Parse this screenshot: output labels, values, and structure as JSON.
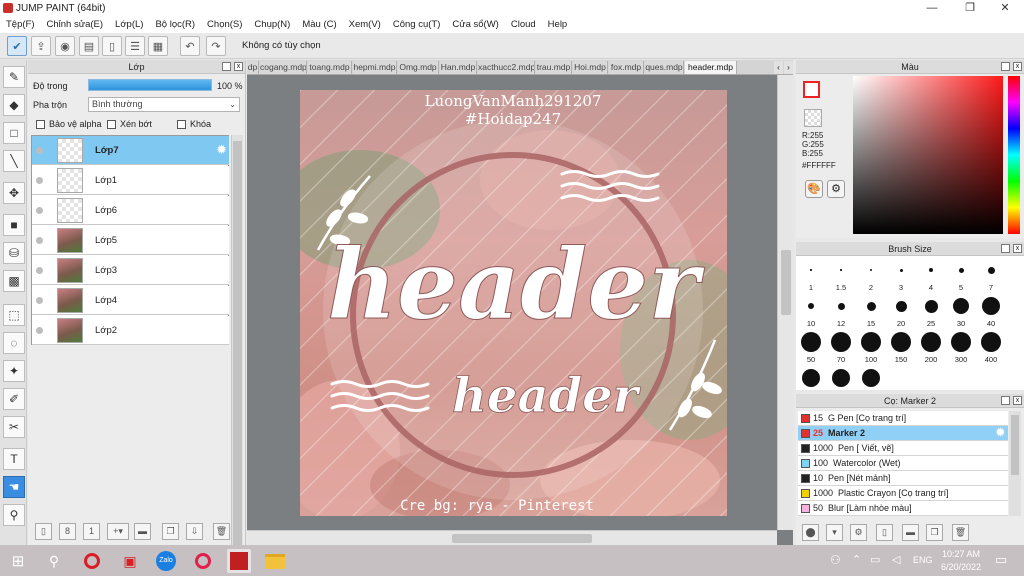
{
  "window": {
    "title": "JUMP PAINT (64bit)",
    "minimize_glyph": "—",
    "maximize_glyph": "❐",
    "close_glyph": "✕"
  },
  "menu": [
    "Tệp(F)",
    "Chỉnh sửa(E)",
    "Lớp(L)",
    "Bộ lọc(R)",
    "Chọn(S)",
    "Chụp(N)",
    "Màu (C)",
    "Xem(V)",
    "Công cụ(T)",
    "Cửa sổ(W)",
    "Cloud",
    "Help"
  ],
  "toolbar": {
    "selection_info": "Không có tùy chọn"
  },
  "layer_panel": {
    "title": "Lớp",
    "opacity_label": "Độ trong",
    "opacity_value": "100 %",
    "opacity_percent": 100,
    "blend_label": "Pha trộn",
    "blend_value": "Bình thường",
    "protect_alpha": "Bảo vệ alpha",
    "clipping": "Xén bớt",
    "lock": "Khóa",
    "layers": [
      {
        "name": "Lớp7",
        "selected": true,
        "has_image": false
      },
      {
        "name": "Lớp1",
        "selected": false,
        "has_image": false
      },
      {
        "name": "Lớp6",
        "selected": false,
        "has_image": false
      },
      {
        "name": "Lớp5",
        "selected": false,
        "has_image": true
      },
      {
        "name": "Lớp3",
        "selected": false,
        "has_image": true
      },
      {
        "name": "Lớp4",
        "selected": false,
        "has_image": true
      },
      {
        "name": "Lớp2",
        "selected": false,
        "has_image": true
      }
    ]
  },
  "tabs": [
    {
      "label": "dp",
      "current": false
    },
    {
      "label": "cogang.mdp",
      "current": false
    },
    {
      "label": "toang.mdp",
      "current": false
    },
    {
      "label": "hepmi.mdp",
      "current": false
    },
    {
      "label": "Omg.mdp",
      "current": false
    },
    {
      "label": "Han.mdp",
      "current": false
    },
    {
      "label": "xacthucc2.mdp",
      "current": false
    },
    {
      "label": "trau.mdp",
      "current": false
    },
    {
      "label": "Hoi.mdp",
      "current": false
    },
    {
      "label": "fox.mdp",
      "current": false
    },
    {
      "label": "ques.mdp",
      "current": false
    },
    {
      "label": "header.mdp",
      "current": true
    }
  ],
  "artwork": {
    "watermark_line1": "LuongVanManh291207",
    "watermark_line2": "#Hoidap247",
    "main_text": "header",
    "sub_text": "header",
    "credit": "Cre bg: rya - Pinterest"
  },
  "color_panel": {
    "title": "Màu",
    "r": "R:255",
    "g": "G:255",
    "b": "B:255",
    "hex": "#FFFFFF",
    "fg": "#ffffff"
  },
  "brush_panel": {
    "title": "Brush Size",
    "sizes": [
      "1",
      "1.5",
      "2",
      "3",
      "4",
      "5",
      "7",
      "10",
      "12",
      "15",
      "20",
      "25",
      "30",
      "40",
      "50",
      "70",
      "100",
      "150",
      "200",
      "300",
      "400",
      "",
      "",
      ""
    ]
  },
  "pen_panel": {
    "title": "Cọ: Marker 2",
    "items": [
      {
        "size": "15",
        "name": "G Pen [Cọ trang trí]",
        "color": "#e53030",
        "selected": false
      },
      {
        "size": "25",
        "name": "Marker 2",
        "color": "#e53030",
        "selected": true
      },
      {
        "size": "1000",
        "name": "Pen [ Viết, vẽ]",
        "color": "#222222",
        "selected": false
      },
      {
        "size": "100",
        "name": "Watercolor (Wet)",
        "color": "#7fd3f0",
        "selected": false
      },
      {
        "size": "10",
        "name": "Pen [Nét mảnh]",
        "color": "#222222",
        "selected": false
      },
      {
        "size": "1000",
        "name": "Plastic Crayon [Cọ trang trí]",
        "color": "#f0d000",
        "selected": false
      },
      {
        "size": "50",
        "name": "Blur [Làm nhòe màu]",
        "color": "#f6b3dd",
        "selected": false
      }
    ]
  },
  "taskbar": {
    "time": "10:27 AM",
    "date": "6/20/2022",
    "lang": "ENG"
  }
}
